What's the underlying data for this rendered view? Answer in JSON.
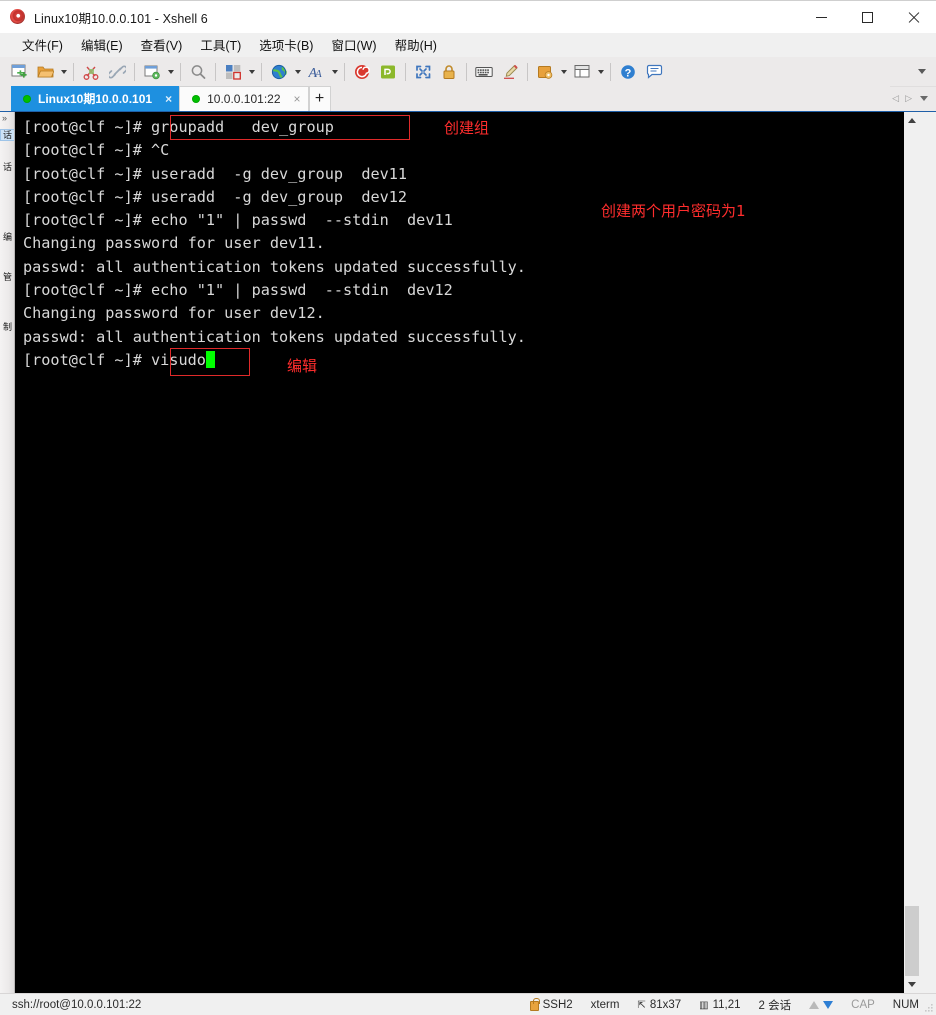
{
  "window": {
    "title": "Linux10期10.0.0.101 - Xshell 6",
    "app_icon": "xshell-spiral-icon",
    "controls": {
      "minimize": "—",
      "maximize": "□",
      "close": "✕"
    }
  },
  "menubar": {
    "items": [
      {
        "label": "文件(F)",
        "name": "menu-file"
      },
      {
        "label": "编辑(E)",
        "name": "menu-edit"
      },
      {
        "label": "查看(V)",
        "name": "menu-view"
      },
      {
        "label": "工具(T)",
        "name": "menu-tools"
      },
      {
        "label": "选项卡(B)",
        "name": "menu-tabs"
      },
      {
        "label": "窗口(W)",
        "name": "menu-window"
      },
      {
        "label": "帮助(H)",
        "name": "menu-help"
      }
    ]
  },
  "toolbar": {
    "icons": [
      "new-session-icon",
      "open-folder-icon",
      "cut-icon",
      "link-icon",
      "session-properties-icon",
      "search-icon",
      "layout-icon",
      "globe-icon",
      "font-icon",
      "xshell-icon",
      "xftp-icon",
      "fullscreen-icon",
      "lock-icon",
      "keyboard-icon",
      "highlight-pen-icon",
      "quick-command-icon",
      "compose-pane-icon",
      "help-icon",
      "chat-icon"
    ],
    "overflow_label": "▾"
  },
  "tabs": {
    "items": [
      {
        "label": "Linux10期10.0.0.101",
        "active": true,
        "status": "connected",
        "close": "×"
      },
      {
        "label": "10.0.0.101:22",
        "active": false,
        "status": "connected",
        "close": "×"
      }
    ],
    "add_label": "+",
    "nav_prev": "◁",
    "nav_next": "▷"
  },
  "side_dock": {
    "arrow": "»",
    "items": [
      {
        "label": "会话管理器",
        "short": "话"
      },
      {
        "label": "编辑",
        "short": "编"
      }
    ]
  },
  "terminal": {
    "prompt": "[root@clf ~]#",
    "lines": [
      "[root@clf ~]# groupadd   dev_group",
      "[root@clf ~]# ^C",
      "[root@clf ~]# useradd  -g dev_group  dev11",
      "[root@clf ~]# useradd  -g dev_group  dev12",
      "[root@clf ~]# echo \"1\" | passwd  --stdin  dev11",
      "Changing password for user dev11.",
      "passwd: all authentication tokens updated successfully.",
      "[root@clf ~]# echo \"1\" | passwd  --stdin  dev12",
      "Changing password for user dev12.",
      "passwd: all authentication tokens updated successfully."
    ],
    "last_prompt": "[root@clf ~]# ",
    "last_command": "visudo",
    "cursor": "block-cursor",
    "colors": {
      "background": "#000000",
      "foreground": "#d8d8d8",
      "cursor": "#00ff00",
      "annotation": "#ff2d2d"
    }
  },
  "annotations": [
    {
      "text": "创建组",
      "name": "annotation-create-group"
    },
    {
      "text": "创建两个用户密码为1",
      "name": "annotation-create-users"
    },
    {
      "text": "编辑",
      "name": "annotation-edit"
    }
  ],
  "statusbar": {
    "url": "ssh://root@10.0.0.101:22",
    "protocol": "SSH2",
    "terminal_type": "xterm",
    "size": "81x37",
    "cursor_pos": "11,21",
    "sessions": "2 会话",
    "cap": "CAP",
    "num": "NUM"
  }
}
